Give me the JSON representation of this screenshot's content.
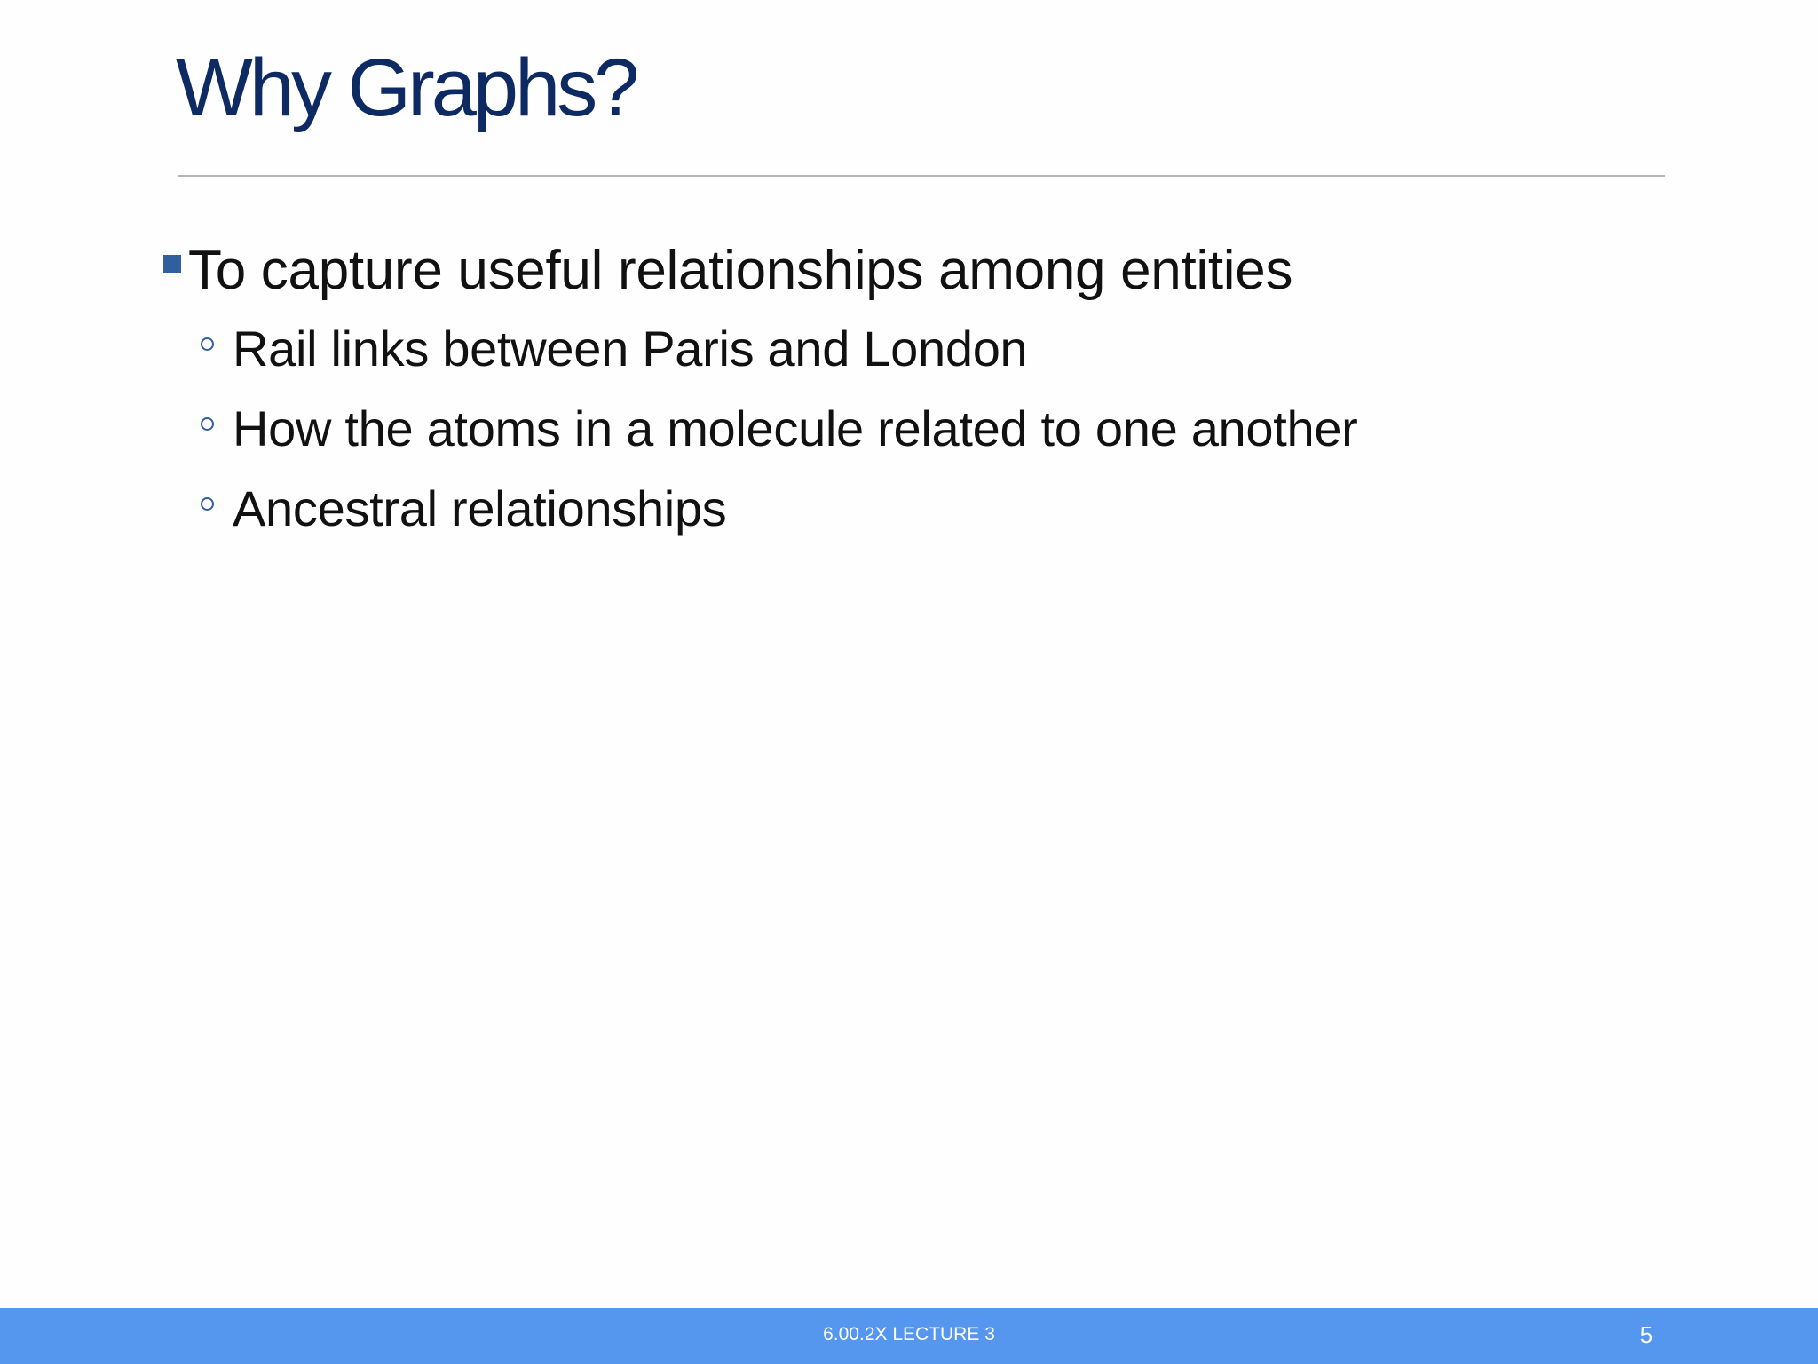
{
  "slide": {
    "title": "Why Graphs?",
    "bullets": [
      {
        "text": "To capture useful relationships among entities",
        "sub": [
          "Rail links between Paris and London",
          "How the atoms in a molecule related to one another",
          "Ancestral relationships"
        ]
      }
    ]
  },
  "footer": {
    "label": "6.00.2X LECTURE 3",
    "page_number": "5"
  },
  "colors": {
    "title": "#0e2a63",
    "bullet_marker": "#2f5f9f",
    "footer_bar": "#5596ee",
    "rule": "#b6b6b6"
  }
}
